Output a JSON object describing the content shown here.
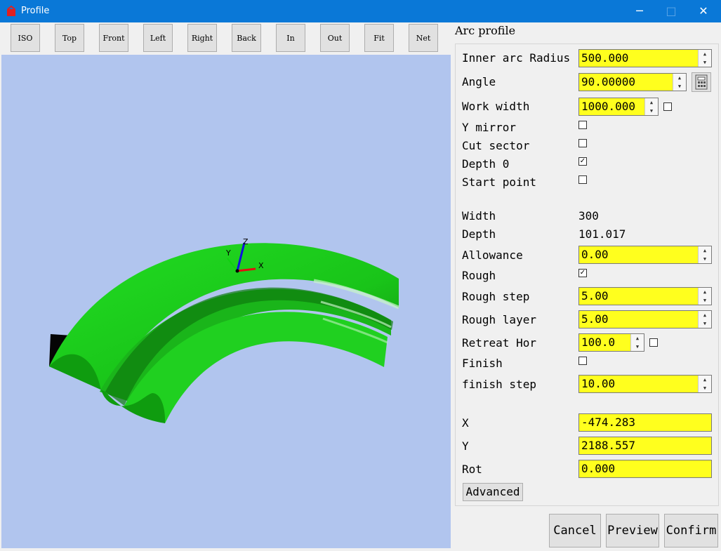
{
  "window": {
    "title": "Profile",
    "min": "─",
    "max": "□",
    "close": "✕"
  },
  "toolbar": [
    "ISO",
    "Top",
    "Front",
    "Left",
    "Right",
    "Back",
    "In",
    "Out",
    "Fit",
    "Net"
  ],
  "axes": {
    "x": "X",
    "y": "Y",
    "z": "Z"
  },
  "panel": {
    "title": "Arc profile",
    "inner_arc_radius": {
      "label": "Inner arc Radius",
      "value": "500.000"
    },
    "angle": {
      "label": "Angle",
      "value": "90.00000"
    },
    "work_width": {
      "label": "Work width",
      "value": "1000.000",
      "checked": false
    },
    "y_mirror": {
      "label": "Y mirror",
      "checked": false
    },
    "cut_sector": {
      "label": "Cut sector",
      "checked": false
    },
    "depth0": {
      "label": "Depth 0",
      "checked": true
    },
    "start_point": {
      "label": "Start point",
      "checked": false
    },
    "width": {
      "label": "Width",
      "value": "300"
    },
    "depth": {
      "label": "Depth",
      "value": "101.017"
    },
    "allowance": {
      "label": "Allowance",
      "value": "0.00"
    },
    "rough": {
      "label": "Rough",
      "checked": true
    },
    "rough_step": {
      "label": "Rough step",
      "value": "5.00"
    },
    "rough_layer": {
      "label": "Rough layer",
      "value": "5.00"
    },
    "retreat_hor": {
      "label": "Retreat Hor",
      "value": "100.0",
      "checked": false
    },
    "finish": {
      "label": "Finish",
      "checked": false
    },
    "finish_step": {
      "label": "finish step",
      "value": "10.00"
    },
    "x": {
      "label": "X",
      "value": "-474.283"
    },
    "y": {
      "label": "Y",
      "value": "2188.557"
    },
    "rot": {
      "label": "Rot",
      "value": "0.000"
    },
    "advanced": "Advanced"
  },
  "buttons": {
    "cancel": "Cancel",
    "preview": "Preview",
    "confirm": "Confirm"
  },
  "colors": {
    "titlebar": "#0a78d7",
    "viewport": "#b1c5ee",
    "field": "#ffff1e",
    "model": "#1fce1f"
  }
}
